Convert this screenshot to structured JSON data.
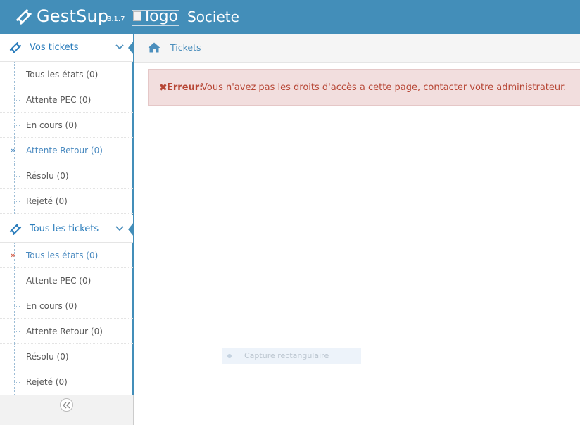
{
  "navbar": {
    "brand_name": "GestSup",
    "version": "3.1.7",
    "logo_alt": "logo",
    "company": "Societe",
    "brand_icon": "ticket-icon",
    "color": "#438eb9"
  },
  "sidebar": {
    "sections": [
      {
        "title": "Vos tickets",
        "icon": "ticket-icon",
        "items": [
          {
            "label": "Tous les états (0)",
            "active": false
          },
          {
            "label": "Attente PEC (0)",
            "active": false
          },
          {
            "label": "En cours (0)",
            "active": false
          },
          {
            "label": "Attente Retour (0)",
            "active": true,
            "arrow_color": "#4a8ac0"
          },
          {
            "label": "Résolu (0)",
            "active": false
          },
          {
            "label": "Rejeté (0)",
            "active": false
          }
        ]
      },
      {
        "title": "Tous les tickets",
        "icon": "ticket-icon",
        "items": [
          {
            "label": "Tous les états (0)",
            "active": true,
            "arrow_color": "#d15b47"
          },
          {
            "label": "Attente PEC (0)",
            "active": false
          },
          {
            "label": "En cours (0)",
            "active": false
          },
          {
            "label": "Attente Retour (0)",
            "active": false
          },
          {
            "label": "Résolu (0)",
            "active": false
          },
          {
            "label": "Rejeté (0)",
            "active": false
          }
        ]
      }
    ],
    "collapse_icon": "double-chevron-left-icon"
  },
  "breadcrumb": {
    "icon": "home-icon",
    "label": "Tickets"
  },
  "alert": {
    "icon": "x-icon",
    "strong": "Erreur:",
    "message": "Vous n'avez pas les droits d'accès a cette page, contacter votre administrateur.",
    "color": "#b74635"
  },
  "overlay": {
    "label": "Capture rectangulaire"
  }
}
